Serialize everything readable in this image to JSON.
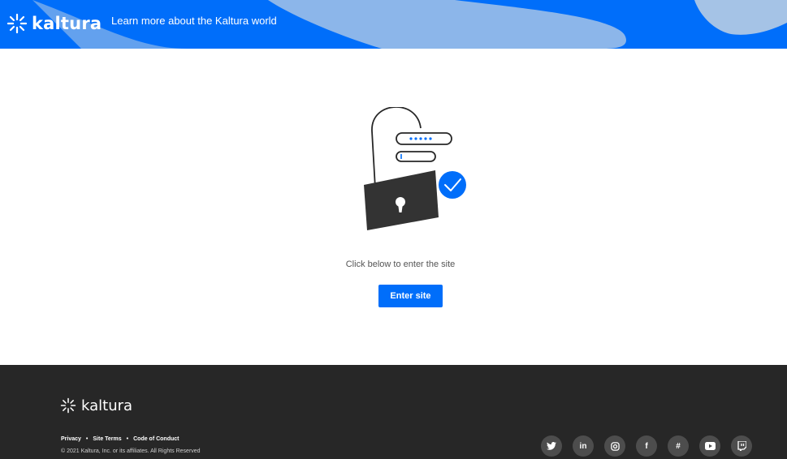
{
  "header": {
    "logo_text": "kaltura",
    "tagline": "Learn more about the Kaltura world",
    "colors": {
      "brand": "#006efa",
      "swoosh": "#a5c3e6"
    }
  },
  "main": {
    "illustration": "lock-with-password-and-checkmark",
    "instruction": "Click below to enter the site",
    "enter_button": "Enter site"
  },
  "footer": {
    "logo_text": "kaltura",
    "links": [
      "Privacy",
      "Site Terms",
      "Code of Conduct"
    ],
    "copyright": "© 2021 Kaltura, Inc. or its affiliates. All Rights Reserved",
    "social": [
      {
        "name": "twitter-icon",
        "glyph": "🐦"
      },
      {
        "name": "linkedin-icon",
        "glyph": "in"
      },
      {
        "name": "instagram-icon",
        "glyph": "◙"
      },
      {
        "name": "facebook-icon",
        "glyph": "f"
      },
      {
        "name": "slack-icon",
        "glyph": "#"
      },
      {
        "name": "youtube-icon",
        "glyph": "▶"
      },
      {
        "name": "twitch-icon",
        "glyph": "▣"
      }
    ],
    "background": "#272727"
  }
}
